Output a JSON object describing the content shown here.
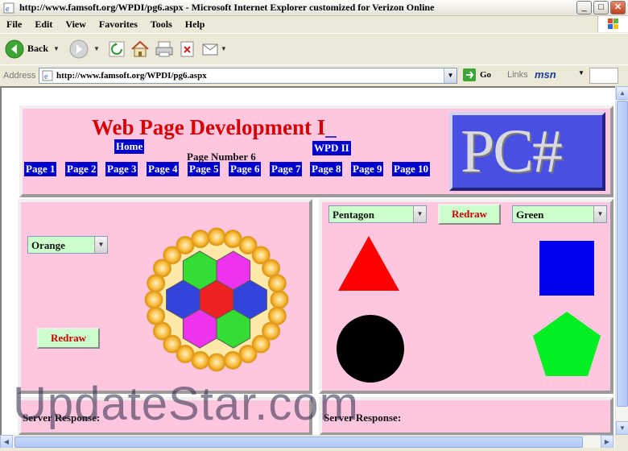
{
  "window": {
    "title": "http://www.famsoft.org/WPDI/pg6.aspx - Microsoft Internet Explorer customized for Verizon Online",
    "minimize_glyph": "_",
    "maximize_glyph": "□",
    "close_glyph": "✕"
  },
  "menu": [
    "File",
    "Edit",
    "View",
    "Favorites",
    "Tools",
    "Help"
  ],
  "toolbar": {
    "back_label": "Back",
    "dropdown_glyph": "▼"
  },
  "address": {
    "label": "Address",
    "url": "http://www.famsoft.org/WPDI/pg6.aspx",
    "go_label": "Go",
    "links_label": "Links",
    "msn_label": "msn"
  },
  "page": {
    "title": "Web Page Development I",
    "title_caret": "_",
    "home_label": "Home",
    "page_number": "Page Number 6",
    "next_label": "WPD II",
    "nav_pages": [
      "Page 1",
      "Page 2",
      "Page 3",
      "Page 4",
      "Page 5",
      "Page 6",
      "Page 7",
      "Page 8",
      "Page 9",
      "Page 10"
    ],
    "logo_text": "PC#"
  },
  "left_panel": {
    "color_select": "Orange",
    "redraw_label": "Redraw",
    "ring_color": "#f7b733",
    "hex_colors": [
      "#33dd33",
      "#ee33ee",
      "#3344dd",
      "#ee2222",
      "#3344dd",
      "#ee33ee",
      "#33dd33"
    ]
  },
  "right_panel": {
    "shape_select": "Pentagon",
    "redraw_label": "Redraw",
    "color_select": "Green",
    "shapes": [
      {
        "name": "triangle",
        "color": "#ff0000"
      },
      {
        "name": "square",
        "color": "#0000ee"
      },
      {
        "name": "circle",
        "color": "#000000"
      },
      {
        "name": "pentagon",
        "color": "#00ee22"
      }
    ]
  },
  "server_response_label": "Server Response:",
  "watermark": "UpdateStar.com"
}
